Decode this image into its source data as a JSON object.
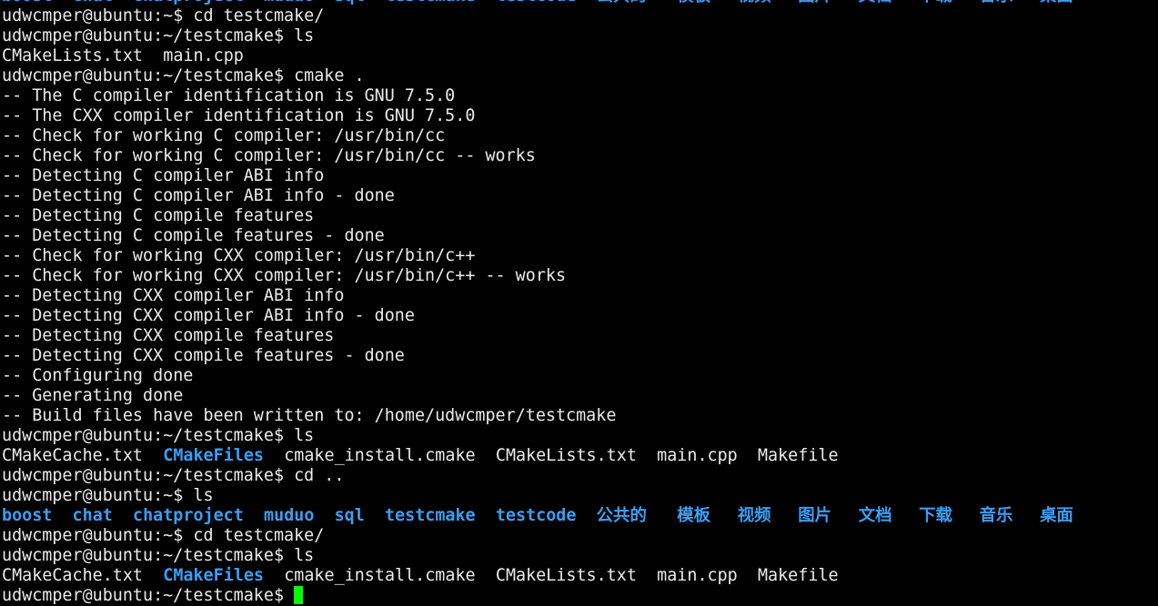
{
  "terminal": {
    "colors": {
      "text": "#ececec",
      "directory": "#3a9ff5",
      "cursor": "#00ff00",
      "background": "#000000"
    },
    "prompt_home": "udwcmper@ubuntu:~$ ",
    "prompt_testcmake": "udwcmper@ubuntu:~/testcmake$ ",
    "lines": [
      {
        "type": "list",
        "items": [
          {
            "name": "boost",
            "dir": true
          },
          {
            "name": "chat",
            "dir": true
          },
          {
            "name": "chatproject",
            "dir": true
          },
          {
            "name": "muduo",
            "dir": true
          },
          {
            "name": "sql",
            "dir": true
          },
          {
            "name": "testcmake",
            "dir": true
          },
          {
            "name": "testcode",
            "dir": true
          },
          {
            "name": "公共的",
            "dir": true
          },
          {
            "name": "模板",
            "dir": true
          },
          {
            "name": "视频",
            "dir": true
          },
          {
            "name": "图片",
            "dir": true
          },
          {
            "name": "文档",
            "dir": true
          },
          {
            "name": "下载",
            "dir": true
          },
          {
            "name": "音乐",
            "dir": true
          },
          {
            "name": "桌面",
            "dir": true
          }
        ]
      },
      {
        "type": "text",
        "text": "udwcmper@ubuntu:~$ cd testcmake/"
      },
      {
        "type": "text",
        "text": "udwcmper@ubuntu:~/testcmake$ ls"
      },
      {
        "type": "list",
        "items": [
          {
            "name": "CMakeLists.txt",
            "dir": false
          },
          {
            "name": "main.cpp",
            "dir": false
          }
        ]
      },
      {
        "type": "text",
        "text": "udwcmper@ubuntu:~/testcmake$ cmake ."
      },
      {
        "type": "text",
        "text": "-- The C compiler identification is GNU 7.5.0"
      },
      {
        "type": "text",
        "text": "-- The CXX compiler identification is GNU 7.5.0"
      },
      {
        "type": "text",
        "text": "-- Check for working C compiler: /usr/bin/cc"
      },
      {
        "type": "text",
        "text": "-- Check for working C compiler: /usr/bin/cc -- works"
      },
      {
        "type": "text",
        "text": "-- Detecting C compiler ABI info"
      },
      {
        "type": "text",
        "text": "-- Detecting C compiler ABI info - done"
      },
      {
        "type": "text",
        "text": "-- Detecting C compile features"
      },
      {
        "type": "text",
        "text": "-- Detecting C compile features - done"
      },
      {
        "type": "text",
        "text": "-- Check for working CXX compiler: /usr/bin/c++"
      },
      {
        "type": "text",
        "text": "-- Check for working CXX compiler: /usr/bin/c++ -- works"
      },
      {
        "type": "text",
        "text": "-- Detecting CXX compiler ABI info"
      },
      {
        "type": "text",
        "text": "-- Detecting CXX compiler ABI info - done"
      },
      {
        "type": "text",
        "text": "-- Detecting CXX compile features"
      },
      {
        "type": "text",
        "text": "-- Detecting CXX compile features - done"
      },
      {
        "type": "text",
        "text": "-- Configuring done"
      },
      {
        "type": "text",
        "text": "-- Generating done"
      },
      {
        "type": "text",
        "text": "-- Build files have been written to: /home/udwcmper/testcmake"
      },
      {
        "type": "text",
        "text": "udwcmper@ubuntu:~/testcmake$ ls"
      },
      {
        "type": "list",
        "items": [
          {
            "name": "CMakeCache.txt",
            "dir": false
          },
          {
            "name": "CMakeFiles",
            "dir": true
          },
          {
            "name": "cmake_install.cmake",
            "dir": false
          },
          {
            "name": "CMakeLists.txt",
            "dir": false
          },
          {
            "name": "main.cpp",
            "dir": false
          },
          {
            "name": "Makefile",
            "dir": false
          }
        ]
      },
      {
        "type": "text",
        "text": "udwcmper@ubuntu:~/testcmake$ cd .."
      },
      {
        "type": "text",
        "text": "udwcmper@ubuntu:~$ ls"
      },
      {
        "type": "list",
        "items": [
          {
            "name": "boost",
            "dir": true
          },
          {
            "name": "chat",
            "dir": true
          },
          {
            "name": "chatproject",
            "dir": true
          },
          {
            "name": "muduo",
            "dir": true
          },
          {
            "name": "sql",
            "dir": true
          },
          {
            "name": "testcmake",
            "dir": true
          },
          {
            "name": "testcode",
            "dir": true
          },
          {
            "name": "公共的",
            "dir": true
          },
          {
            "name": "模板",
            "dir": true
          },
          {
            "name": "视频",
            "dir": true
          },
          {
            "name": "图片",
            "dir": true
          },
          {
            "name": "文档",
            "dir": true
          },
          {
            "name": "下载",
            "dir": true
          },
          {
            "name": "音乐",
            "dir": true
          },
          {
            "name": "桌面",
            "dir": true
          }
        ]
      },
      {
        "type": "text",
        "text": "udwcmper@ubuntu:~$ cd testcmake/"
      },
      {
        "type": "text",
        "text": "udwcmper@ubuntu:~/testcmake$ ls"
      },
      {
        "type": "list",
        "items": [
          {
            "name": "CMakeCache.txt",
            "dir": false
          },
          {
            "name": "CMakeFiles",
            "dir": true
          },
          {
            "name": "cmake_install.cmake",
            "dir": false
          },
          {
            "name": "CMakeLists.txt",
            "dir": false
          },
          {
            "name": "main.cpp",
            "dir": false
          },
          {
            "name": "Makefile",
            "dir": false
          }
        ]
      },
      {
        "type": "prompt",
        "text": "udwcmper@ubuntu:~/testcmake$ "
      }
    ]
  }
}
